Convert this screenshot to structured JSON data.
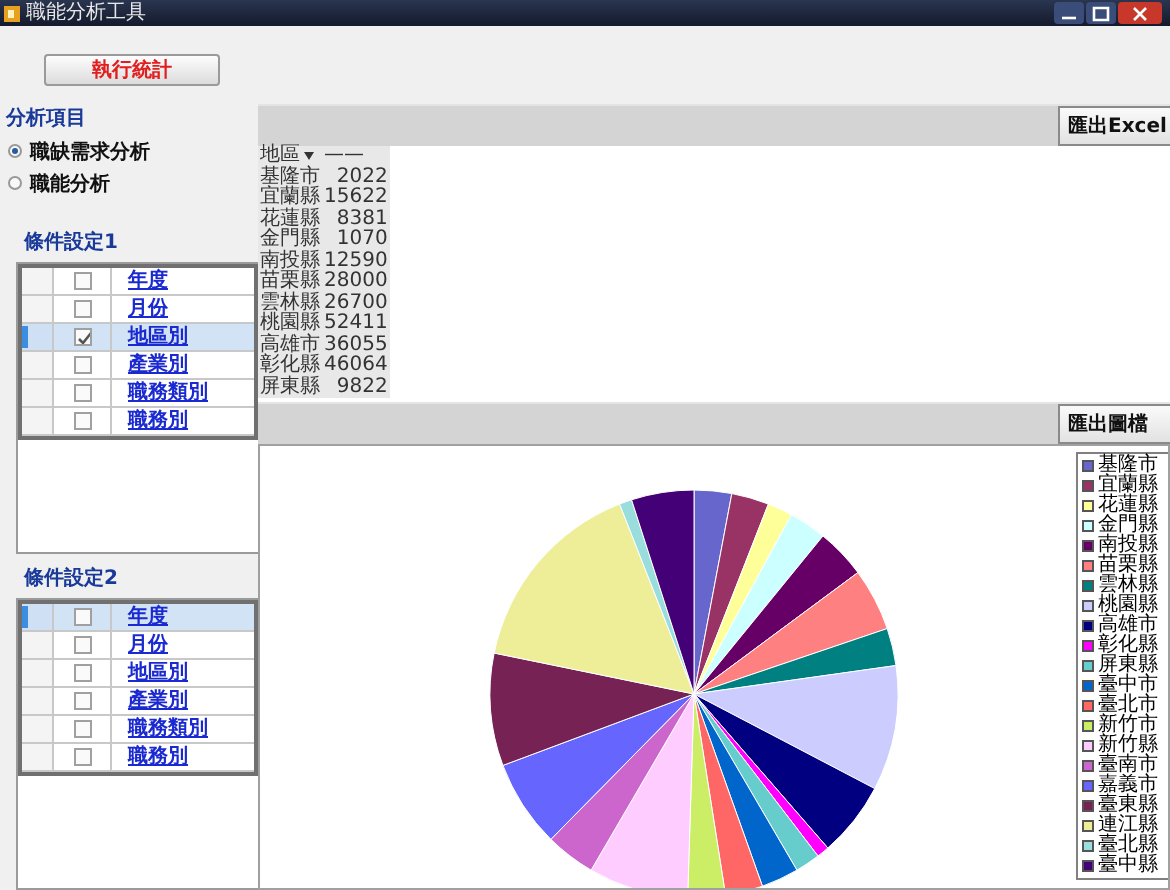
{
  "window": {
    "title": "職能分析工具"
  },
  "run_button": "執行統計",
  "analysis": {
    "heading": "分析項目",
    "options": [
      {
        "label": "職缺需求分析",
        "selected": true
      },
      {
        "label": "職能分析",
        "selected": false
      }
    ]
  },
  "conditions": [
    {
      "heading": "條件設定1",
      "rows": [
        {
          "label": "年度",
          "checked": false,
          "selected": false
        },
        {
          "label": "月份",
          "checked": false,
          "selected": false
        },
        {
          "label": "地區別",
          "checked": true,
          "selected": true
        },
        {
          "label": "產業別",
          "checked": false,
          "selected": false
        },
        {
          "label": "職務類別",
          "checked": false,
          "selected": false
        },
        {
          "label": "職務別",
          "checked": false,
          "selected": false
        }
      ]
    },
    {
      "heading": "條件設定2",
      "rows": [
        {
          "label": "年度",
          "checked": false,
          "selected": true
        },
        {
          "label": "月份",
          "checked": false,
          "selected": false
        },
        {
          "label": "地區別",
          "checked": false,
          "selected": false
        },
        {
          "label": "產業別",
          "checked": false,
          "selected": false
        },
        {
          "label": "職務類別",
          "checked": false,
          "selected": false
        },
        {
          "label": "職務別",
          "checked": false,
          "selected": false
        }
      ]
    }
  ],
  "export_excel": "匯出Excel",
  "table": {
    "columns": [
      "地區",
      "——"
    ],
    "rows": [
      [
        "基隆市",
        "2022"
      ],
      [
        "宜蘭縣",
        "15622"
      ],
      [
        "花蓮縣",
        "8381"
      ],
      [
        "金門縣",
        "1070"
      ],
      [
        "南投縣",
        "12590"
      ],
      [
        "苗栗縣",
        "28000"
      ],
      [
        "雲林縣",
        "26700"
      ],
      [
        "桃園縣",
        "52411"
      ],
      [
        "高雄市",
        "36055"
      ],
      [
        "彰化縣",
        "46064"
      ],
      [
        "屏東縣",
        "9822"
      ]
    ]
  },
  "export_image": "匯出圖檔",
  "legend": [
    {
      "label": "基隆市",
      "color": "#6666cc"
    },
    {
      "label": "宜蘭縣",
      "color": "#993366"
    },
    {
      "label": "花蓮縣",
      "color": "#ffff99"
    },
    {
      "label": "金門縣",
      "color": "#ccffff"
    },
    {
      "label": "南投縣",
      "color": "#660066"
    },
    {
      "label": "苗栗縣",
      "color": "#ff8080"
    },
    {
      "label": "雲林縣",
      "color": "#008080"
    },
    {
      "label": "桃園縣",
      "color": "#ccccff"
    },
    {
      "label": "高雄市",
      "color": "#000080"
    },
    {
      "label": "彰化縣",
      "color": "#ff00ff"
    },
    {
      "label": "屏東縣",
      "color": "#66cccc"
    },
    {
      "label": "臺中市",
      "color": "#0066cc"
    },
    {
      "label": "臺北市",
      "color": "#ff6666"
    },
    {
      "label": "新竹市",
      "color": "#ccee66"
    },
    {
      "label": "新竹縣",
      "color": "#ffccff"
    },
    {
      "label": "臺南市",
      "color": "#cc66cc"
    },
    {
      "label": "嘉義市",
      "color": "#6666ff"
    },
    {
      "label": "臺東縣",
      "color": "#772255"
    },
    {
      "label": "連江縣",
      "color": "#eeee99"
    },
    {
      "label": "臺北縣",
      "color": "#99dddd"
    },
    {
      "label": "臺中縣",
      "color": "#440077"
    }
  ]
}
